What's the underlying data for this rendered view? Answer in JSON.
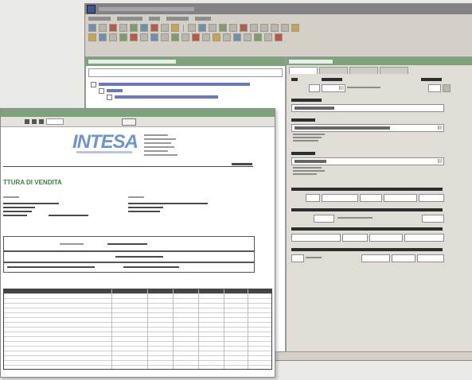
{
  "app": {
    "title": "",
    "menu": [
      "",
      "",
      "",
      "",
      ""
    ],
    "left_pane": {
      "title": "",
      "tree": [
        "",
        "",
        ""
      ]
    },
    "right_pane": {
      "title": "",
      "tabs": [
        "",
        "",
        "",
        ""
      ]
    },
    "form": {
      "fields": [
        {
          "label": "",
          "value": ""
        },
        {
          "label": "",
          "value": ""
        },
        {
          "label": "",
          "value": ""
        },
        {
          "label": "",
          "value": ""
        },
        {
          "label": "",
          "value": ""
        },
        {
          "label": "",
          "value": ""
        }
      ]
    },
    "status": ""
  },
  "document": {
    "logo_text": "INTESA",
    "heading": "TTURA DI VENDITA",
    "page_label": "",
    "buttons": [
      "",
      ""
    ]
  },
  "colors": {
    "accent_green": "#7ea27a",
    "logo_blue": "#6f95cc",
    "heading_green": "#3f7e43"
  }
}
